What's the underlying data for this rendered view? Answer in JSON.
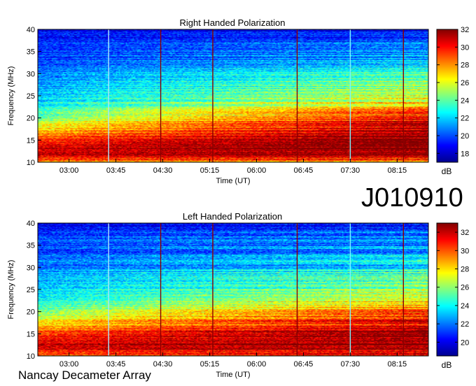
{
  "observation_id": "J010910",
  "credit": "Nancay Decameter Array",
  "chart_data": [
    {
      "type": "heatmap",
      "title": "Right Handed Polarization",
      "xlabel": "Time (UT)",
      "ylabel": "Frequency (MHz)",
      "x_ticks": [
        "03:00",
        "03:45",
        "04:30",
        "05:15",
        "06:00",
        "06:45",
        "07:30",
        "08:15"
      ],
      "x_range": [
        "02:30",
        "08:45"
      ],
      "y_ticks": [
        10,
        15,
        20,
        25,
        30,
        35,
        40
      ],
      "ylim": [
        10,
        40
      ],
      "colorbar": {
        "label": "dB",
        "ticks": [
          18,
          20,
          22,
          24,
          26,
          28,
          30,
          32
        ],
        "range": [
          17,
          32
        ]
      },
      "colormap": "jet",
      "intensity_profile": {
        "frequency_MHz": [
          10,
          12,
          14,
          16,
          18,
          20,
          22,
          24,
          26,
          28,
          30,
          32,
          34,
          36,
          38,
          40
        ],
        "level_dB_start": [
          28,
          31,
          30,
          28,
          26,
          23.5,
          22.5,
          21.5,
          21,
          20.5,
          20,
          19.5,
          19,
          19,
          18.5,
          18
        ],
        "level_dB_end": [
          28,
          32,
          32,
          32,
          31,
          30,
          28,
          26,
          25,
          24.5,
          23,
          22,
          20.5,
          20.5,
          19,
          18
        ]
      },
      "vertical_lines": [
        {
          "time": "03:38",
          "color": "#aee6ff"
        },
        {
          "time": "04:28",
          "color": "#8b0000"
        },
        {
          "time": "05:18",
          "color": "#8b0000"
        },
        {
          "time": "06:39",
          "color": "#8b0000"
        },
        {
          "time": "07:30",
          "color": "#7ff5ff"
        },
        {
          "time": "08:21",
          "color": "#8b0000"
        }
      ]
    },
    {
      "type": "heatmap",
      "title": "Left Handed Polarization",
      "xlabel": "Time (UT)",
      "ylabel": "Frequency (MHz)",
      "x_ticks": [
        "03:00",
        "03:45",
        "04:30",
        "05:15",
        "06:00",
        "06:45",
        "07:30",
        "08:15"
      ],
      "x_range": [
        "02:30",
        "08:45"
      ],
      "y_ticks": [
        10,
        15,
        20,
        25,
        30,
        35,
        40
      ],
      "ylim": [
        10,
        40
      ],
      "colorbar": {
        "label": "dB",
        "ticks": [
          20,
          22,
          24,
          26,
          28,
          30,
          32
        ],
        "range": [
          18.5,
          33
        ]
      },
      "colormap": "jet",
      "intensity_profile": {
        "frequency_MHz": [
          10,
          12,
          14,
          16,
          18,
          20,
          22,
          24,
          26,
          28,
          30,
          32,
          34,
          36,
          38,
          40
        ],
        "level_dB_start": [
          29,
          32,
          31,
          29,
          27,
          25,
          24,
          23,
          22.5,
          22,
          21.5,
          21,
          20.5,
          21,
          20,
          19.5
        ],
        "level_dB_end": [
          30,
          33,
          33,
          32.5,
          31,
          30,
          28,
          26.5,
          25.5,
          24.5,
          23.5,
          23,
          22,
          22,
          21,
          20
        ]
      },
      "vertical_lines": [
        {
          "time": "03:38",
          "color": "#aee6ff"
        },
        {
          "time": "04:28",
          "color": "#8b0000"
        },
        {
          "time": "05:18",
          "color": "#8b0000"
        },
        {
          "time": "06:39",
          "color": "#8b0000"
        },
        {
          "time": "07:30",
          "color": "#7ff5ff"
        },
        {
          "time": "08:21",
          "color": "#8b0000"
        }
      ]
    }
  ]
}
